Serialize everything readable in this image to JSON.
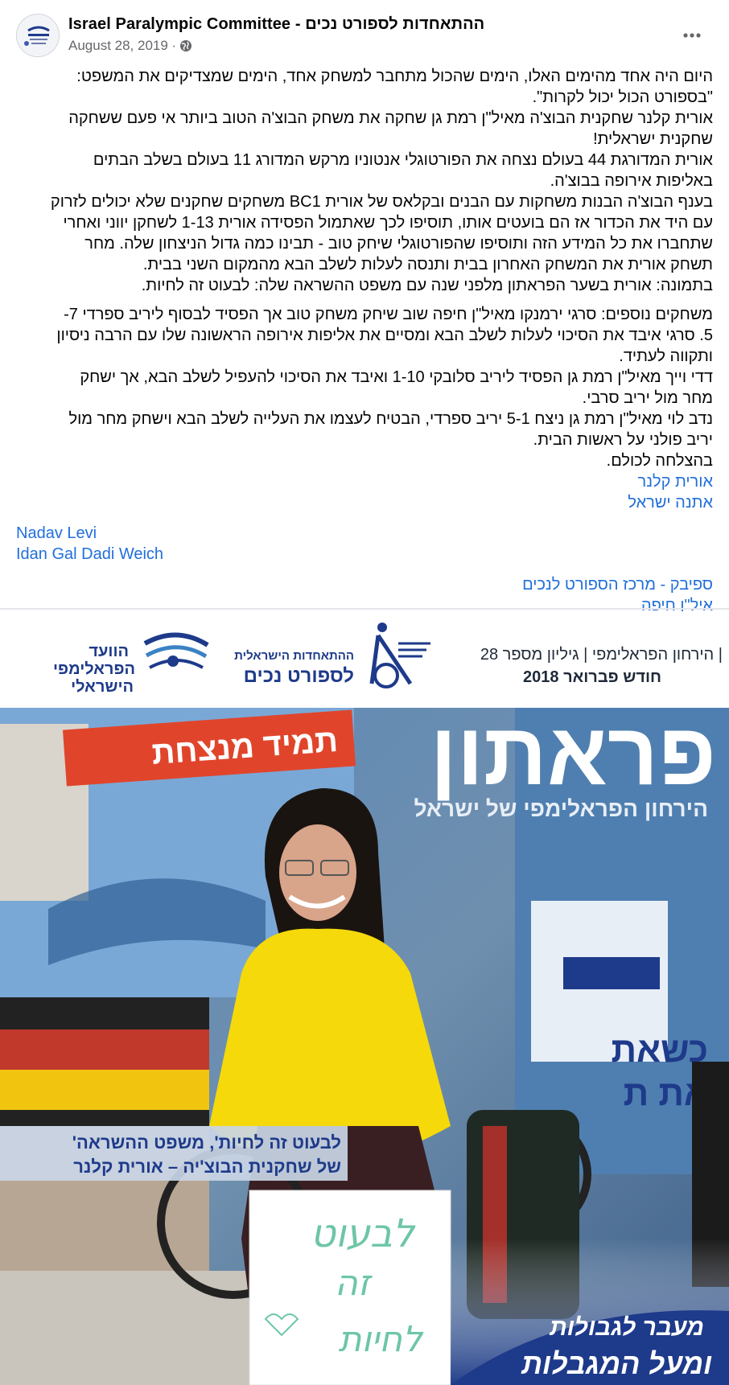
{
  "post": {
    "page_name": "Israel Paralympic Committee - ההתאחדות לספורט נכים",
    "date": "August 28, 2019 ·",
    "text_lines": [
      "היום היה אחד מהימים האלו, הימים שהכול מתחבר למשחק אחד, הימים שמצדיקים את המשפט:",
      "\"בספורט הכול יכול לקרות\".",
      "אורית קלנר שחקנית הבוצ'ה מאיל\"ן רמת גן שחקה את משחק הבוצ'ה הטוב ביותר אי פעם ששחקה",
      "שחקנית ישראלית!",
      "אורית המדורגת 44 בעולם נצחה את הפורטוגלי אנטוניו מרקש המדורג 11 בעולם בשלב הבתים",
      "באליפות אירופה בבוצ'ה.",
      "בענף הבוצ'ה הבנות משחקות עם הבנים ובקלאס של אורית BC1 משחקים שחקנים שלא יכולים לזרוק",
      "עם היד את הכדור אז הם בועטים אותו, תוסיפו לכך שאתמול הפסידה אורית 1-13 לשחקן יווני ואחרי",
      "שתחברו את כל המידע הזה ותוסיפו שהפורטוגלי שיחק טוב - תבינו כמה גדול הניצחון שלה. מחר",
      "תשחק אורית את המשחק האחרון בבית ותנסה לעלות לשלב הבא מהמקום השני בבית.",
      "בתמונה: אורית בשער הפראתון מלפני שנה עם משפט ההשראה שלה: לבעוט זה לחיות."
    ],
    "text_lines_2": [
      "משחקים נוספים: סרגי ירמנקו מאיל\"ן חיפה שוב שיחק משחק טוב אך הפסיד לבסוף ליריב ספרדי 7-",
      "5. סרגי איבד את הסיכוי לעלות לשלב הבא ומסיים את אליפות אירופה הראשונה שלו עם הרבה ניסיון",
      "ותקווה לעתיד.",
      "דדי וייך מאיל\"ן רמת גן הפסיד ליריב סלובקי 1-10 ואיבד את הסיכוי להעפיל לשלב הבא, אך ישחק",
      "מחר מול יריב סרבי.",
      "נדב לוי מאיל\"ן רמת גן ניצח 5-1 יריב ספרדי, הבטיח לעצמו את העלייה לשלב הבא וישחק מחר מול",
      "יריב פולני על ראשות הבית.",
      "בהצלחה לכולם."
    ],
    "tags_rtl": [
      "אורית קלנר",
      "אתנה ישראל"
    ],
    "tags_ltr": [
      "Nadav Levi",
      "Idan Gal Dadi Weich"
    ],
    "tags_rtl_2": [
      "ספיבק - מרכז הספורט לנכים",
      "איל\"ן חיפה"
    ]
  },
  "cover": {
    "committee_logo_line1": "הוועד",
    "committee_logo_line2": "הפראלימפי",
    "committee_logo_line3": "הישראלי",
    "federation_line1": "ההתאחדות הישראלית",
    "federation_line2": "לספורט נכים",
    "issue_line1": "הירחון הפראלימפי | גיליון מספר 28 |",
    "issue_line2": "חודש פברואר 2018",
    "magazine_title": "פראתון",
    "magazine_subtitle": "הירחון הפראלימפי של ישראל",
    "banner_text": "תמיד מנצחת",
    "poster_text_1": "כשאת",
    "poster_text_2": "את ת",
    "quote_line1": "'לבעוט זה לחיות', משפט ההשראה",
    "quote_line2": "של שחקנית הבוצ'יה – אורית קלנר",
    "sign_line1": "לבעוט",
    "sign_line2": "זה",
    "sign_line3": "לחיות",
    "slogan_line1": "מעבר לגבולות",
    "slogan_line2": "ומעל המגבלות",
    "colors": {
      "navy": "#1e3a8a",
      "yellow_top": "#f5d90a",
      "banner_red": "#e0452c",
      "sign_green": "#6dc6a6",
      "quote_bg": "#c9d6e6"
    }
  },
  "icons": {
    "globe": "globe-icon",
    "more": "more-icon"
  }
}
